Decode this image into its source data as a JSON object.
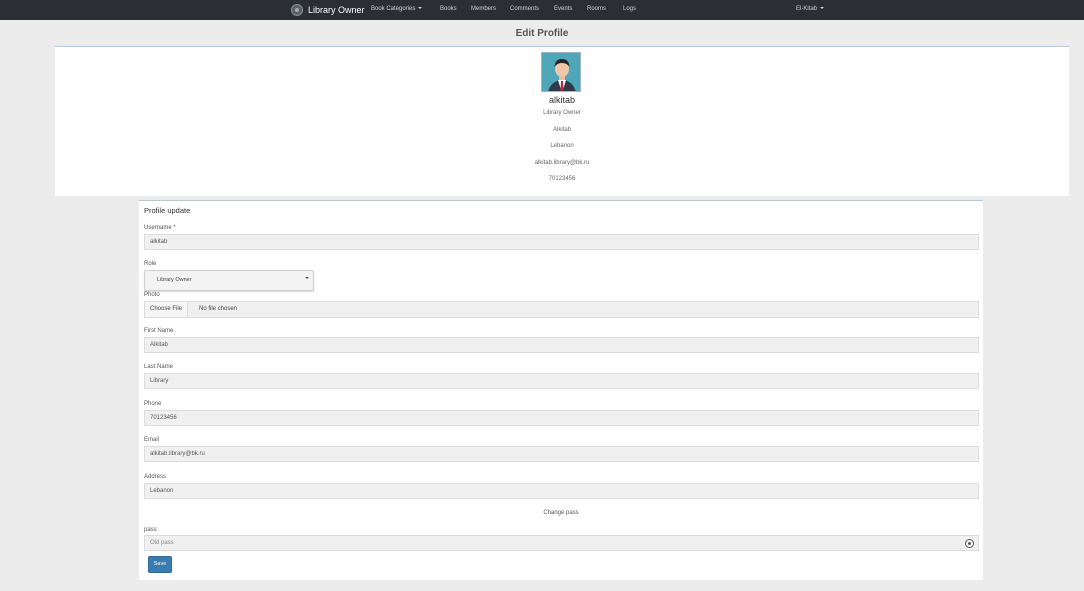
{
  "navbar": {
    "brand": "Library Owner",
    "items": [
      {
        "label": "Book Categories"
      },
      {
        "label": "Books"
      },
      {
        "label": "Members"
      },
      {
        "label": "Comments"
      },
      {
        "label": "Events"
      },
      {
        "label": "Rooms"
      },
      {
        "label": "Logs"
      }
    ],
    "user_menu": "El-Kitab"
  },
  "page": {
    "title": "Edit Profile"
  },
  "profile": {
    "name": "alkitab",
    "role": "Library Owner",
    "first_name": "Alkitab",
    "address": "Lebanon",
    "email": "alkitab.library@bk.ru",
    "phone": "70123456"
  },
  "form": {
    "heading": "Profile update",
    "username": {
      "label": "Username *",
      "value": "alkitab"
    },
    "role": {
      "label": "Role",
      "value": "Library Owner"
    },
    "photo": {
      "label": "Photo",
      "button": "Choose File",
      "status": "No file chosen"
    },
    "first_name": {
      "label": "First Name",
      "value": "Alkitab"
    },
    "last_name": {
      "label": "Last Name",
      "value": "Library"
    },
    "phone": {
      "label": "Phone",
      "value": "70123456"
    },
    "email": {
      "label": "Email",
      "value": "alkitab.library@bk.ru"
    },
    "address": {
      "label": "Address",
      "value": "Lebanon"
    },
    "change_pass": "Change pass",
    "pass": {
      "label": "pass",
      "placeholder": "Old pass"
    },
    "save": "Save"
  },
  "colors": {
    "navbar_bg": "#2b2f33",
    "save_button": "#3a7bb0",
    "page_bg": "#ececec"
  }
}
